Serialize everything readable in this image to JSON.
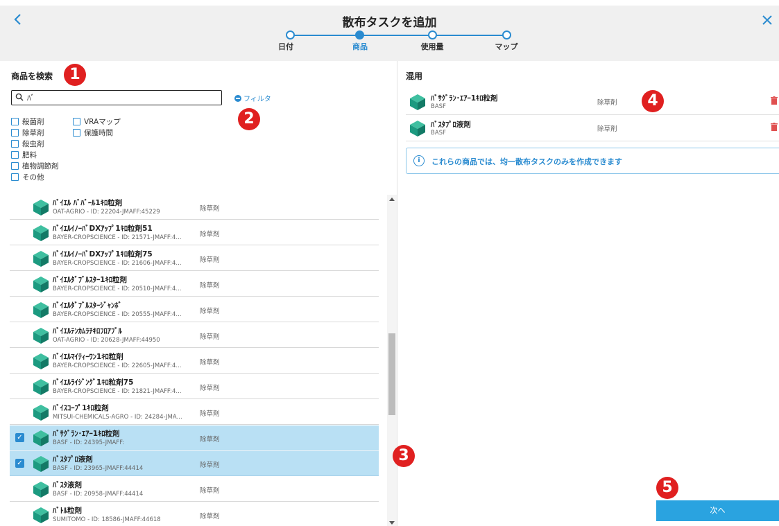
{
  "header": {
    "title": "散布タスクを追加",
    "back_icon": "chevron-left-icon",
    "close_icon": "close-icon",
    "steps": [
      {
        "label": "日付",
        "active": false
      },
      {
        "label": "商品",
        "active": true
      },
      {
        "label": "使用量",
        "active": false
      },
      {
        "label": "マップ",
        "active": false
      }
    ],
    "accent_color": "#2a8bd0"
  },
  "search": {
    "title": "商品を検索",
    "value": "ﾊﾞ",
    "filter_label": "フィルタ"
  },
  "filters": {
    "col1": [
      "殺菌剤",
      "除草剤",
      "殺虫剤",
      "肥料",
      "植物調節剤",
      "その他"
    ],
    "col2": [
      "VRAマップ",
      "保護時間"
    ]
  },
  "products": [
    {
      "name": "ﾊﾞｲｴﾙ ﾊﾞﾊﾞｰﾙ1ｷﾛ粒剤",
      "sub": "OAT-AGRIO - ID: 22204-JMAFF:45229",
      "category": "除草剤",
      "selected": false
    },
    {
      "name": "ﾊﾞｲｴﾙｲﾉｰﾊﾞDXｱｯﾌﾟ1ｷﾛ粒剤51",
      "sub": "BAYER-CROPSCIENCE - ID: 21571-JMAFF:4...",
      "category": "除草剤",
      "selected": false
    },
    {
      "name": "ﾊﾞｲｴﾙｲﾉｰﾊﾞDXｱｯﾌﾟ1ｷﾛ粒剤75",
      "sub": "BAYER-CROPSCIENCE - ID: 21606-JMAFF:4...",
      "category": "除草剤",
      "selected": false
    },
    {
      "name": "ﾊﾞｲｴﾙﾀﾞﾌﾞﾙｽﾀｰ1ｷﾛ粒剤",
      "sub": "BAYER-CROPSCIENCE - ID: 20510-JMAFF:4...",
      "category": "除草剤",
      "selected": false
    },
    {
      "name": "ﾊﾞｲｴﾙﾀﾞﾌﾞﾙｽﾀｰｼﾞｬﾝﾎﾞ",
      "sub": "BAYER-CROPSCIENCE - ID: 20555-JMAFF:4...",
      "category": "除草剤",
      "selected": false
    },
    {
      "name": "ﾊﾞｲｴﾙﾃﾝｶﾑﾗﾁｷﾛﾌﾛｱﾌﾞﾙ",
      "sub": "OAT-AGRIO - ID: 20628-JMAFF:44950",
      "category": "除草剤",
      "selected": false
    },
    {
      "name": "ﾊﾞｲｴﾙﾏｲﾃｨｰﾜﾝ1ｷﾛ粒剤",
      "sub": "BAYER-CROPSCIENCE - ID: 22605-JMAFF:4...",
      "category": "除草剤",
      "selected": false
    },
    {
      "name": "ﾊﾞｲｴﾙﾗｲｼﾞﾝｸﾞ1ｷﾛ粒剤75",
      "sub": "BAYER-CROPSCIENCE - ID: 21821-JMAFF:4...",
      "category": "除草剤",
      "selected": false
    },
    {
      "name": "ﾊﾞｲｽｺｰﾌﾟ1ｷﾛ粒剤",
      "sub": "MITSUI-CHEMICALS-AGRO - ID: 24284-JMA...",
      "category": "除草剤",
      "selected": false
    },
    {
      "name": "ﾊﾞｻｸﾞﾗﾝ･ｴｱｰ1ｷﾛ粒剤",
      "sub": "BASF - ID: 24395-JMAFF:",
      "category": "除草剤",
      "selected": true
    },
    {
      "name": "ﾊﾞｽﾀﾌﾟﾛ液剤",
      "sub": "BASF - ID: 23965-JMAFF:44414",
      "category": "除草剤",
      "selected": true
    },
    {
      "name": "ﾊﾞｽﾀ液剤",
      "sub": "BASF - ID: 20958-JMAFF:44414",
      "category": "除草剤",
      "selected": false
    },
    {
      "name": "ﾊﾞﾄﾙ粒剤",
      "sub": "SUMITOMO - ID: 18586-JMAFF:44618",
      "category": "除草剤",
      "selected": false
    }
  ],
  "mix": {
    "title": "混用",
    "items": [
      {
        "name": "ﾊﾞｻｸﾞﾗﾝ･ｴｱｰ1ｷﾛ粒剤",
        "sub": "BASF",
        "category": "除草剤"
      },
      {
        "name": "ﾊﾞｽﾀﾌﾟﾛ液剤",
        "sub": "BASF",
        "category": "除草剤"
      }
    ],
    "info": "これらの商品では、均一散布タスクのみを作成できます"
  },
  "next_label": "次へ",
  "badges": [
    "1",
    "2",
    "3",
    "4",
    "5"
  ]
}
